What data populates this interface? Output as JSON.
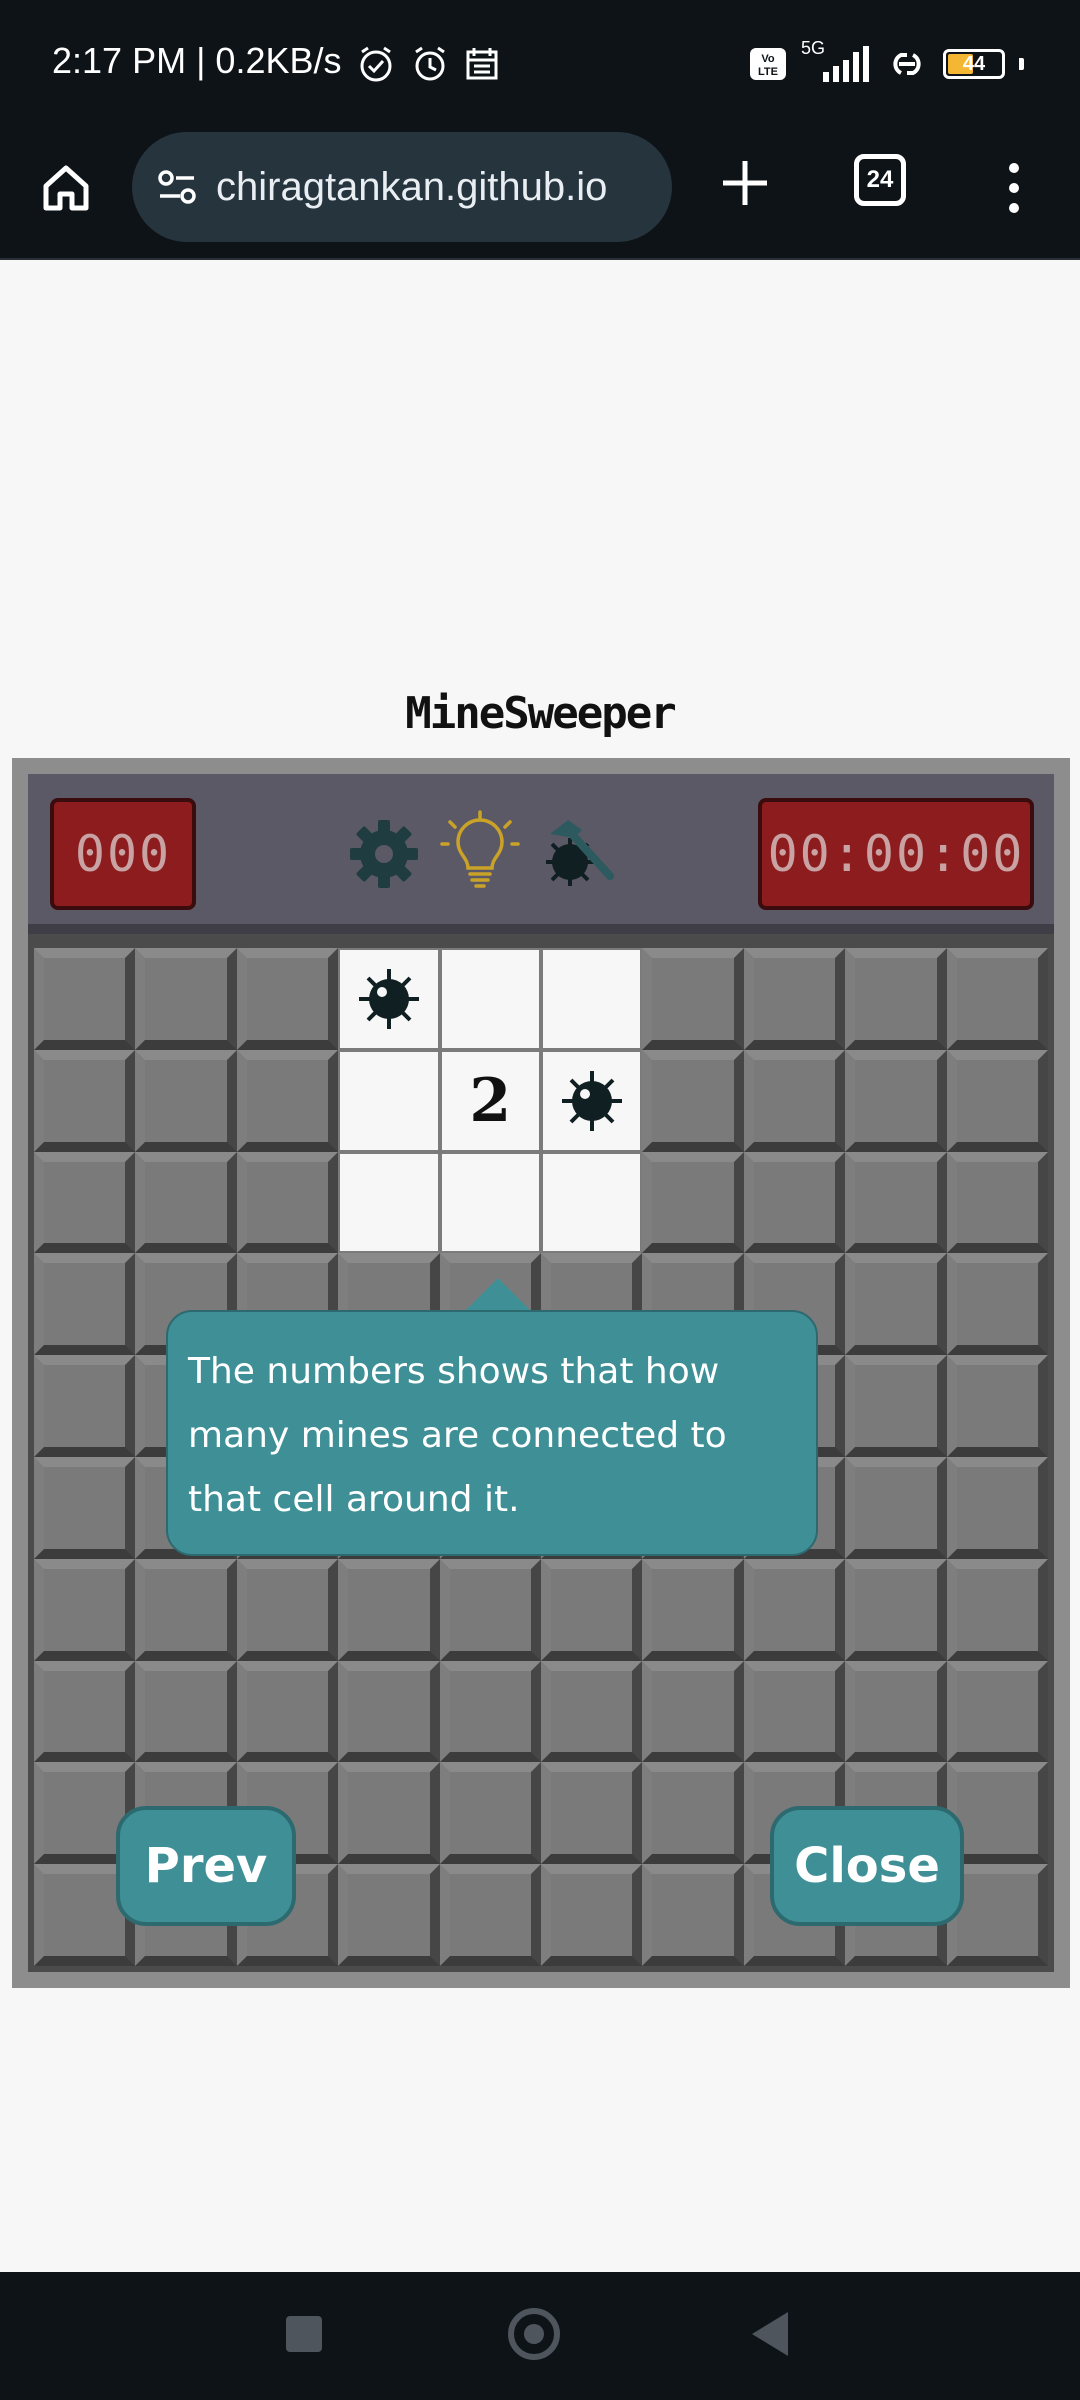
{
  "status_bar": {
    "time": "2:17 PM | 0.2KB/s",
    "battery": "44",
    "network": "5G"
  },
  "browser": {
    "url": "chiragtankan.github.io",
    "tab_count": "24"
  },
  "game": {
    "title": "MineSweeper",
    "mine_counter": "000",
    "timer": "00:00:00",
    "revealed_number": "2",
    "tooltip": "The numbers shows that how many mines are connected to that cell around it.",
    "prev_label": "Prev",
    "close_label": "Close"
  },
  "colors": {
    "accent": "#3f8f96",
    "counter": "#8c1c1e"
  }
}
